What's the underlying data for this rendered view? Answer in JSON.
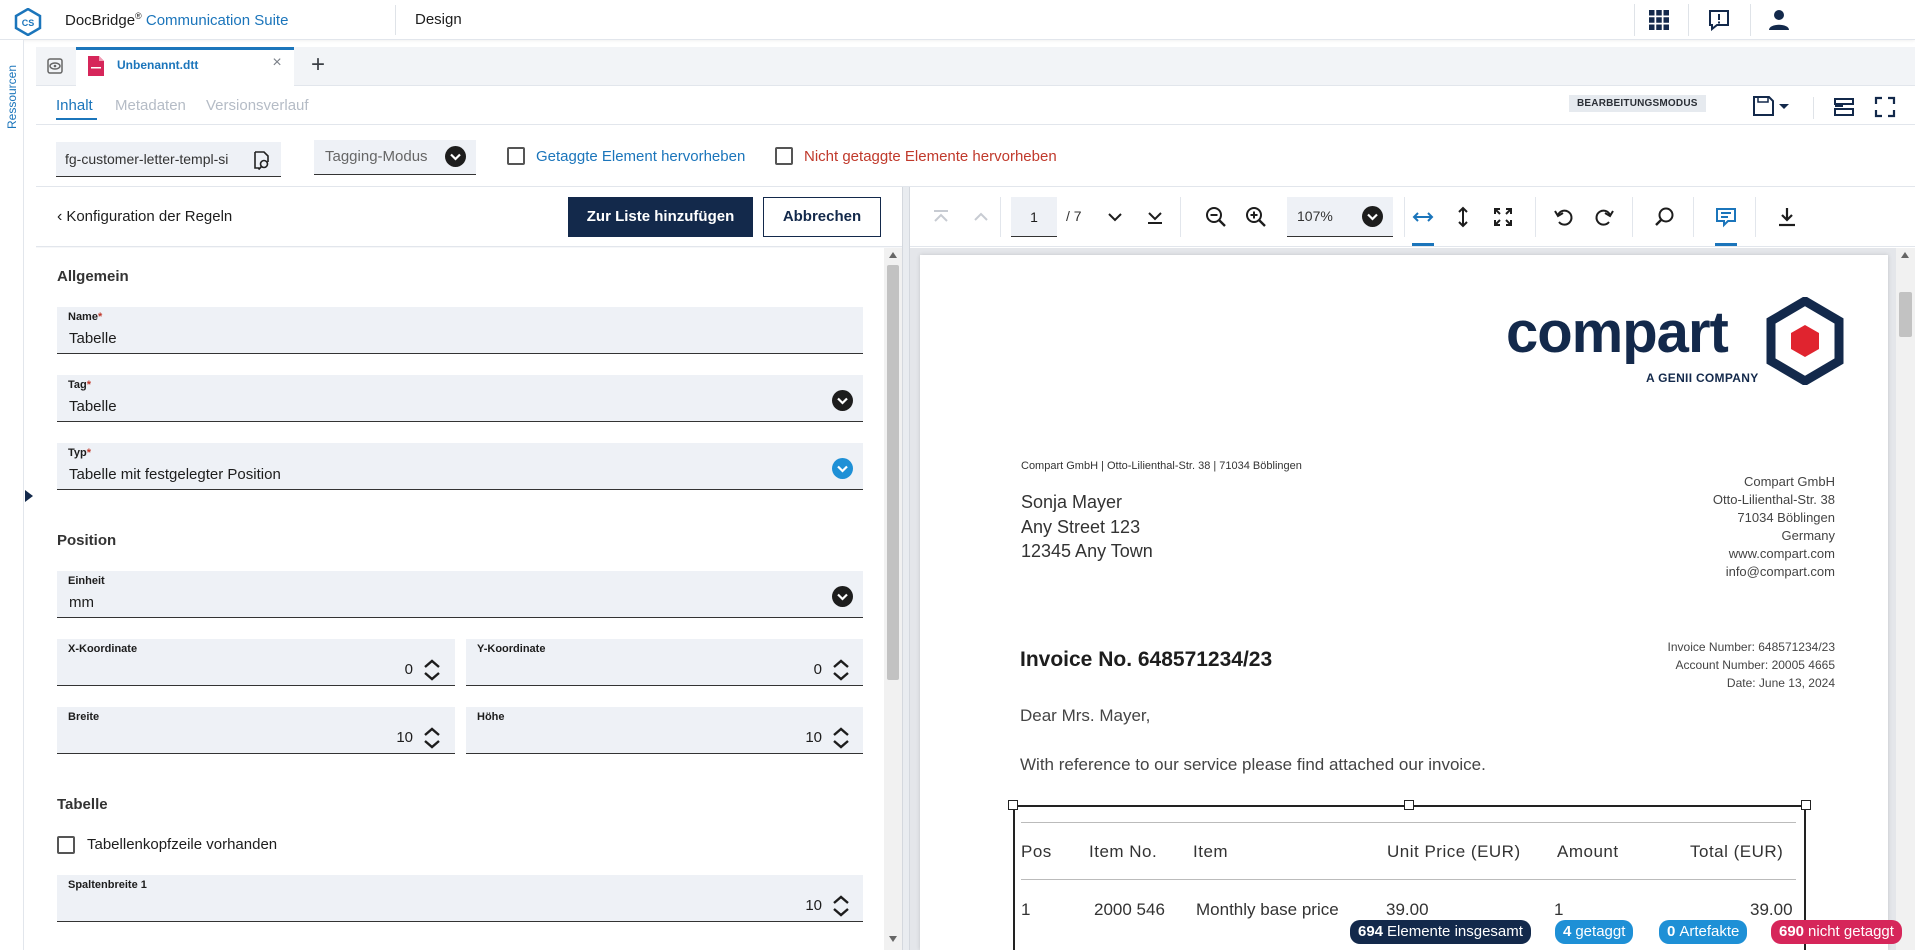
{
  "app": {
    "logo_text": "CS",
    "name_primary": "DocBridge",
    "name_reg": "®",
    "name_accent": "Communication Suite",
    "section": "Design"
  },
  "rail": {
    "label": "Ressourcen"
  },
  "tabs": {
    "document": {
      "label": "Unbenannt.dtt",
      "close": "×"
    },
    "add": "+"
  },
  "subtabs": [
    {
      "label": "Inhalt",
      "active": true
    },
    {
      "label": "Metadaten",
      "active": false
    },
    {
      "label": "Versionsverlauf",
      "active": false
    }
  ],
  "mode_badge": "BEARBEITUNGSMODUS",
  "filters": {
    "template": "fg-customer-letter-templ-si",
    "tagging_mode": "Tagging-Modus",
    "highlight_tagged": {
      "label": "Getaggte Element hervorheben",
      "checked": false
    },
    "highlight_untagged": {
      "label": "Nicht getaggte Elemente hervorheben",
      "checked": false
    }
  },
  "rules": {
    "back_label": "Konfiguration der Regeln",
    "add_button": "Zur Liste hinzufügen",
    "cancel_button": "Abbrechen",
    "general": {
      "title": "Allgemein",
      "name": {
        "label": "Name",
        "required": "*",
        "value": "Tabelle"
      },
      "tag": {
        "label": "Tag",
        "required": "*",
        "value": "Tabelle"
      },
      "type": {
        "label": "Typ",
        "required": "*",
        "value": "Tabelle mit festgelegter Position"
      }
    },
    "position": {
      "title": "Position",
      "unit": {
        "label": "Einheit",
        "value": "mm"
      },
      "x": {
        "label": "X-Koordinate",
        "value": "0"
      },
      "y": {
        "label": "Y-Koordinate",
        "value": "0"
      },
      "width": {
        "label": "Breite",
        "value": "10"
      },
      "height": {
        "label": "Höhe",
        "value": "10"
      }
    },
    "table": {
      "title": "Tabelle",
      "header_row": {
        "label": "Tabellenkopfzeile vorhanden",
        "checked": false
      },
      "column_width_1": {
        "label": "Spaltenbreite 1",
        "value": "10"
      }
    }
  },
  "viewer": {
    "page_current": "1",
    "page_total": "/ 7",
    "zoom": "107%"
  },
  "document": {
    "logo_text": "compart",
    "logo_sub": "A GENII COMPANY",
    "sender_line": "Compart GmbH | Otto-Lilienthal-Str. 38 | 71034 Böblingen",
    "recipient": [
      "Sonja Mayer",
      "Any Street 123",
      "12345 Any Town"
    ],
    "company_block": [
      "Compart GmbH",
      "Otto-Lilienthal-Str. 38",
      "71034 Böblingen",
      "Germany",
      "www.compart.com",
      "info@compart.com"
    ],
    "title": "Invoice No. 648571234/23",
    "meta": [
      "Invoice Number: 648571234/23",
      "Account Number: 20005 4665",
      "Date: June 13, 2024"
    ],
    "greeting": "Dear Mrs. Mayer,",
    "intro": "With reference to our service please find attached our invoice.",
    "table": {
      "headers": [
        "Pos",
        "Item No.",
        "Item",
        "Unit Price (EUR)",
        "Amount",
        "Total (EUR)"
      ],
      "rows": [
        [
          "1",
          "2000 546",
          "Monthly base price",
          "39.00",
          "1",
          "39.00"
        ]
      ]
    }
  },
  "status": {
    "total": {
      "count": "694",
      "label": "Elemente insgesamt",
      "color": "#13294b"
    },
    "tagged": {
      "count": "4",
      "label": "getaggt",
      "color": "#1e90d6"
    },
    "artifacts": {
      "count": "0",
      "label": "Artefakte",
      "color": "#1e90d6"
    },
    "untagged": {
      "count": "690",
      "label": "nicht getaggt",
      "color": "#d6265a"
    }
  },
  "colors": {
    "accent": "#1b75bb",
    "navy": "#13294b",
    "danger": "#c0392b"
  }
}
